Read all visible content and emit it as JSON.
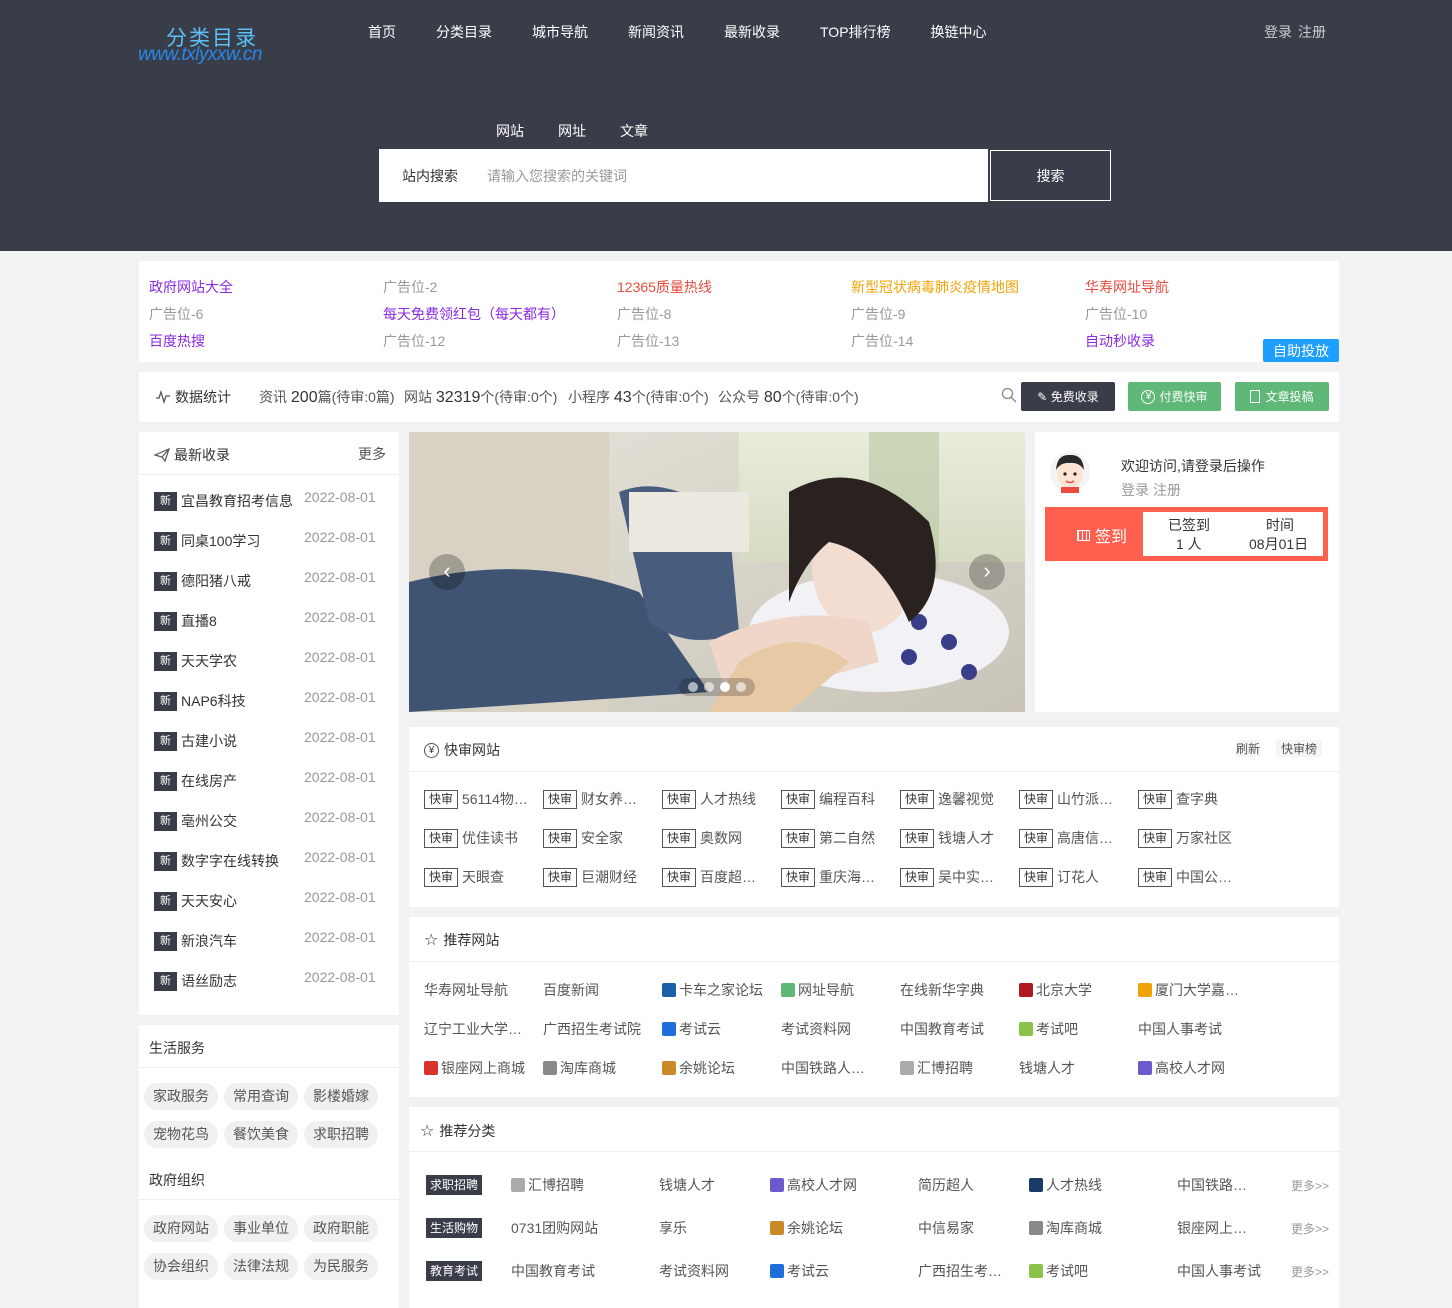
{
  "logo": {
    "title": "分类目录",
    "url": "www.txlyxxw.cn"
  },
  "nav": [
    "首页",
    "分类目录",
    "城市导航",
    "新闻资讯",
    "最新收录",
    "TOP排行榜",
    "换链中心"
  ],
  "auth": {
    "login": "登录",
    "register": "注册"
  },
  "search": {
    "tabs": [
      "网站",
      "网址",
      "文章"
    ],
    "label": "站内搜索",
    "placeholder": "请输入您搜索的关键词",
    "button": "搜索"
  },
  "ads": {
    "rows": [
      [
        {
          "t": "政府网站大全",
          "c": "#8a2be2"
        },
        {
          "t": "广告位-2",
          "c": "#999"
        },
        {
          "t": "12365质量热线",
          "c": "#e74c3c"
        },
        {
          "t": "新型冠状病毒肺炎疫情地图",
          "c": "#f0a30a"
        },
        {
          "t": "华寿网址导航",
          "c": "#e74c3c"
        }
      ],
      [
        {
          "t": "广告位-6",
          "c": "#999"
        },
        {
          "t": "每天免费领红包（每天都有）",
          "c": "#8a2be2"
        },
        {
          "t": "广告位-8",
          "c": "#999"
        },
        {
          "t": "广告位-9",
          "c": "#999"
        },
        {
          "t": "广告位-10",
          "c": "#999"
        }
      ],
      [
        {
          "t": "百度热搜",
          "c": "#8a2be2"
        },
        {
          "t": "广告位-12",
          "c": "#999"
        },
        {
          "t": "广告位-13",
          "c": "#999"
        },
        {
          "t": "广告位-14",
          "c": "#999"
        },
        {
          "t": "自动秒收录",
          "c": "#8a2be2"
        }
      ]
    ],
    "self_button": "自助投放"
  },
  "stats": {
    "title": "数据统计",
    "items": [
      {
        "label": "资讯",
        "num": "200",
        "unit": "篇(待审:0篇)"
      },
      {
        "label": "网站",
        "num": "32319",
        "unit": "个(待审:0个)"
      },
      {
        "label": "小程序",
        "num": "43",
        "unit": "个(待审:0个)"
      },
      {
        "label": "公众号",
        "num": "80",
        "unit": "个(待审:0个)"
      }
    ],
    "buttons": [
      {
        "label": "免费收录",
        "color": "#393d49"
      },
      {
        "label": "付费快审",
        "color": "#5fb878"
      },
      {
        "label": "文章投稿",
        "color": "#5fb878"
      }
    ]
  },
  "latest": {
    "title": "最新收录",
    "more": "更多",
    "badge": "新",
    "items": [
      {
        "name": "宜昌教育招考信息",
        "date": "2022-08-01"
      },
      {
        "name": "同桌100学习",
        "date": "2022-08-01"
      },
      {
        "name": "德阳猪八戒",
        "date": "2022-08-01"
      },
      {
        "name": "直播8",
        "date": "2022-08-01"
      },
      {
        "name": "天天学农",
        "date": "2022-08-01"
      },
      {
        "name": "NAP6科技",
        "date": "2022-08-01"
      },
      {
        "name": "古建小说",
        "date": "2022-08-01"
      },
      {
        "name": "在线房产",
        "date": "2022-08-01"
      },
      {
        "name": "亳州公交",
        "date": "2022-08-01"
      },
      {
        "name": "数字字在线转换",
        "date": "2022-08-01"
      },
      {
        "name": "天天安心",
        "date": "2022-08-01"
      },
      {
        "name": "新浪汽车",
        "date": "2022-08-01"
      },
      {
        "name": "语丝励志",
        "date": "2022-08-01"
      }
    ]
  },
  "life": {
    "title": "生活服务",
    "tags": [
      "家政服务",
      "常用查询",
      "影楼婚嫁",
      "宠物花鸟",
      "餐饮美食",
      "求职招聘"
    ]
  },
  "gov": {
    "title": "政府组织",
    "tags": [
      "政府网站",
      "事业单位",
      "政府职能",
      "协会组织",
      "法律法规",
      "为民服务"
    ]
  },
  "carousel": {
    "dots": 4,
    "active": 3
  },
  "user": {
    "welcome": "欢迎访问,请登录后操作",
    "login": "登录",
    "register": "注册",
    "checkin": "签到",
    "signed_label": "已签到",
    "signed_value": "1 人",
    "time_label": "时间",
    "time_value": "08月01日"
  },
  "quick": {
    "title": "快审网站",
    "refresh": "刷新",
    "rank": "快审榜",
    "badge": "快审",
    "rows": [
      [
        "56114物…",
        "财女养…",
        "人才热线",
        "编程百科",
        "逸馨视觉",
        "山竹派…",
        "查字典"
      ],
      [
        "优佳读书",
        "安全家",
        "奥数网",
        "第二自然",
        "钱塘人才",
        "高唐信…",
        "万家社区"
      ],
      [
        "天眼查",
        "巨潮财经",
        "百度超…",
        "重庆海…",
        "吴中实…",
        "订花人",
        "中国公…"
      ]
    ]
  },
  "recommend": {
    "title": "推荐网站",
    "rows": [
      [
        "华寿网址导航",
        "百度新闻",
        "卡车之家论坛",
        "网址导航",
        "在线新华字典",
        "北京大学",
        "厦门大学嘉…"
      ],
      [
        "辽宁工业大学…",
        "广西招生考试院",
        "考试云",
        "考试资料网",
        "中国教育考试",
        "考试吧",
        "中国人事考试"
      ],
      [
        "银座网上商城",
        "淘库商城",
        "余姚论坛",
        "中国铁路人…",
        "汇博招聘",
        "钱塘人才",
        "高校人才网"
      ]
    ]
  },
  "categories": {
    "title": "推荐分类",
    "more": "更多>>",
    "rows": [
      {
        "badge": "求职招聘",
        "sites": [
          "汇博招聘",
          "钱塘人才",
          "高校人才网",
          "简历超人",
          "人才热线",
          "中国铁路…"
        ]
      },
      {
        "badge": "生活购物",
        "sites": [
          "0731团购网站",
          "享乐",
          "余姚论坛",
          "中信易家",
          "淘库商城",
          "银座网上…"
        ]
      },
      {
        "badge": "教育考试",
        "sites": [
          "中国教育考试",
          "考试资料网",
          "考试云",
          "广西招生考…",
          "考试吧",
          "中国人事考试"
        ]
      }
    ]
  },
  "colors": {
    "header": "#393d49",
    "green": "#5fb878",
    "blue": "#1e9fff",
    "checkin": "#fe5f4e"
  }
}
